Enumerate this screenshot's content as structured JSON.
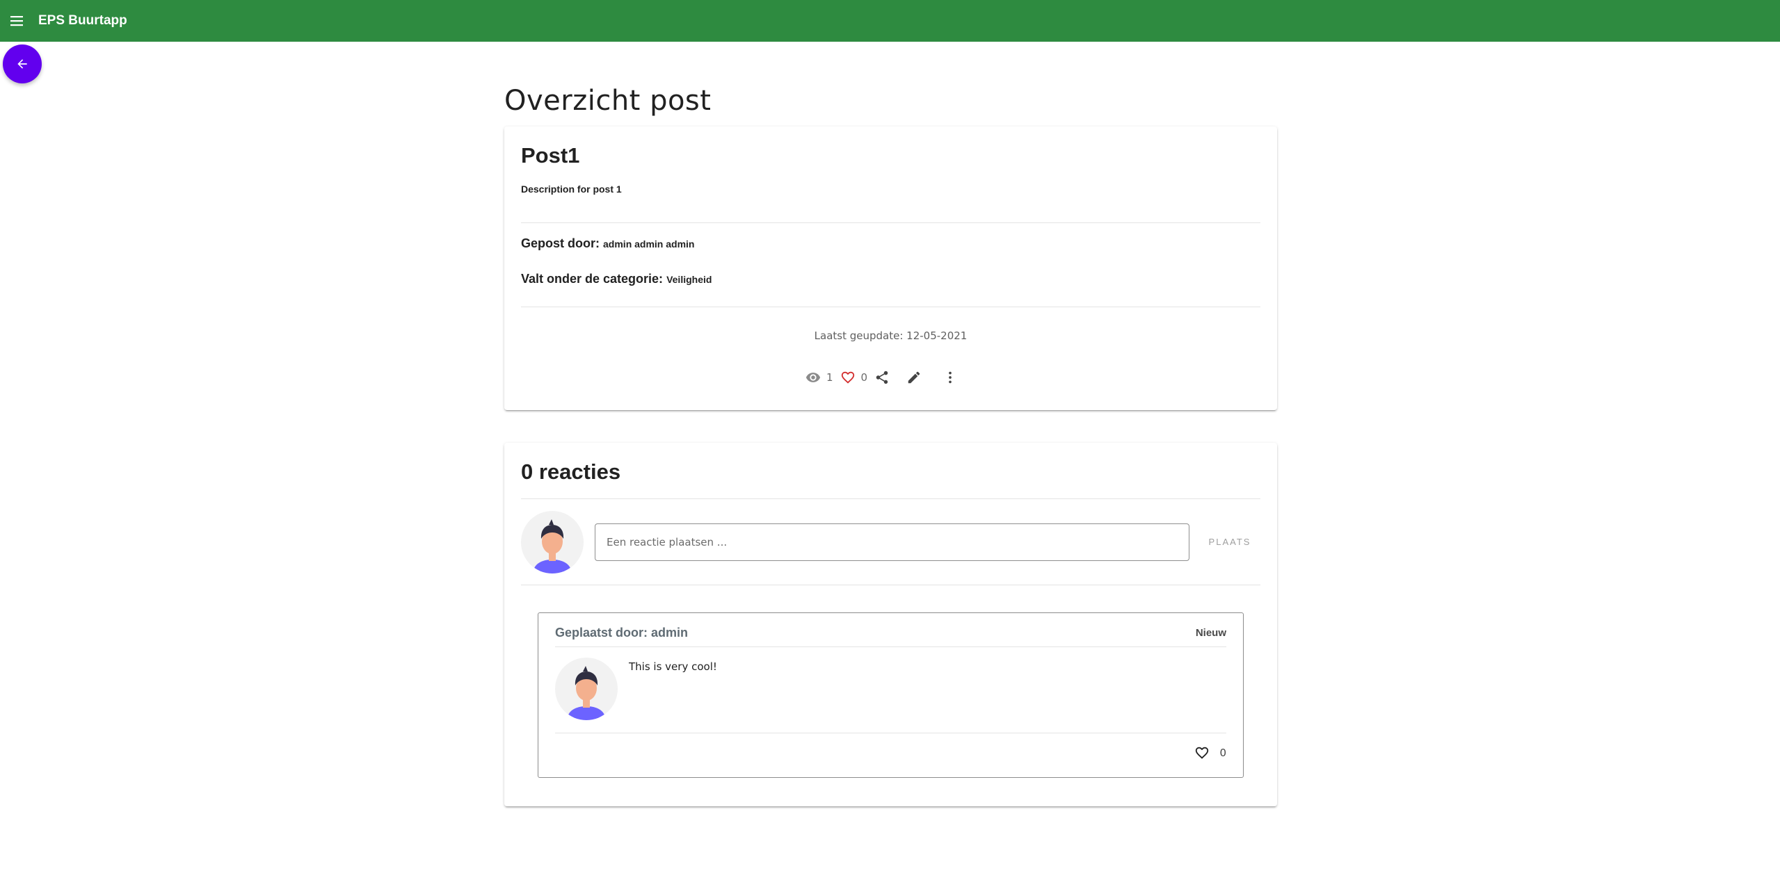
{
  "appbar": {
    "title": "EPS Buurtapp",
    "color": "#2e8b40"
  },
  "page": {
    "title": "Overzicht post"
  },
  "post": {
    "title": "Post1",
    "description": "Description for post 1",
    "posted_by_label": "Gepost door:",
    "posted_by": "admin admin admin",
    "category_label": "Valt onder de categorie:",
    "category": "Veiligheid",
    "updated": "Laatst geupdate: 12-05-2021",
    "views": "1",
    "likes": "0",
    "icons": [
      "eye-icon",
      "heart-icon",
      "share-icon",
      "edit-icon",
      "more-vert-icon"
    ]
  },
  "comments": {
    "title": "0 reacties",
    "input_placeholder": "Een reactie plaatsen ...",
    "submit_label": "PLAATS",
    "items": [
      {
        "author": "Geplaatst door: admin",
        "badge": "Nieuw",
        "text": "This is very cool!",
        "likes": "0"
      }
    ]
  },
  "colors": {
    "fab": "#6200ee",
    "like_heart": "#d32f2f"
  }
}
